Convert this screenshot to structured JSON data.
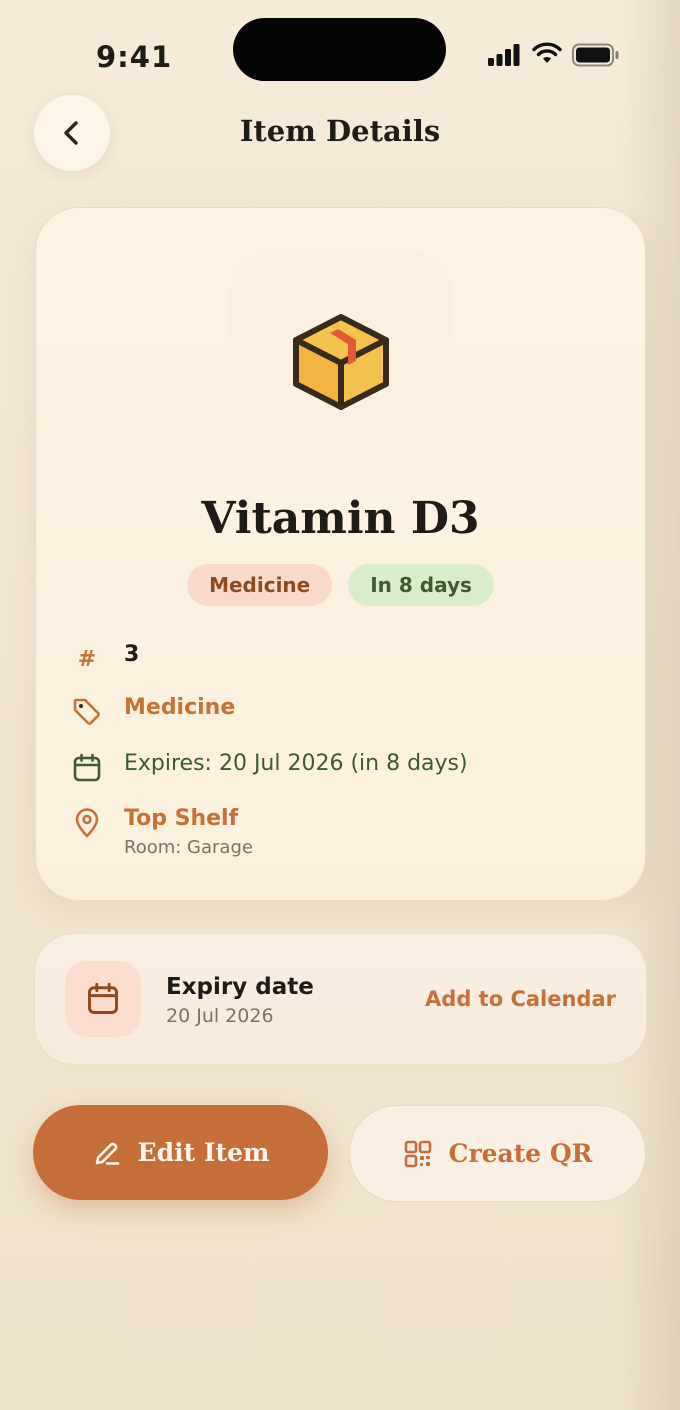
{
  "status": {
    "time": "9:41"
  },
  "header": {
    "title": "Item Details"
  },
  "item": {
    "name": "Vitamin D3",
    "category_badge": "Medicine",
    "expiry_badge": "In 8 days",
    "quantity_symbol": "#",
    "quantity": "3",
    "category": "Medicine",
    "expires_text": "Expires: 20 Jul 2026 (in 8 days)",
    "location": "Top Shelf",
    "room": "Room: Garage"
  },
  "expiry_card": {
    "title": "Expiry date",
    "date": "20 Jul 2026",
    "action": "Add to Calendar"
  },
  "actions": {
    "edit_label": "Edit Item",
    "qr_label": "Create QR"
  },
  "colors": {
    "accent": "#c56e3a",
    "green": "#3e5b2f",
    "background": "#f3e7d4"
  },
  "icons": {
    "back": "chevron-left-icon",
    "item": "package-box-icon",
    "category": "tag-icon",
    "expiry": "calendar-icon",
    "location": "map-pin-icon",
    "edit": "pencil-icon",
    "qr": "qr-code-icon"
  }
}
